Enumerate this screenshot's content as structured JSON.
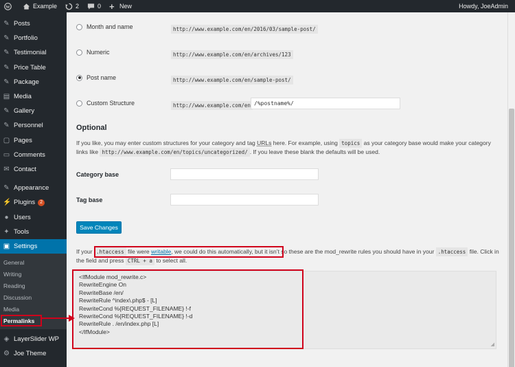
{
  "adminbar": {
    "site_name": "Example",
    "updates_count": "2",
    "comments_count": "0",
    "new_label": "New",
    "howdy": "Howdy, JoeAdmin"
  },
  "sidebar": {
    "items": [
      {
        "label": "Posts",
        "icon": "pin-icon"
      },
      {
        "label": "Portfolio",
        "icon": "pin-icon"
      },
      {
        "label": "Testimonial",
        "icon": "pin-icon"
      },
      {
        "label": "Price Table",
        "icon": "pin-icon"
      },
      {
        "label": "Package",
        "icon": "pin-icon"
      },
      {
        "label": "Media",
        "icon": "media-icon"
      },
      {
        "label": "Gallery",
        "icon": "pin-icon"
      },
      {
        "label": "Personnel",
        "icon": "pin-icon"
      },
      {
        "label": "Pages",
        "icon": "pages-icon"
      },
      {
        "label": "Comments",
        "icon": "comments-icon"
      },
      {
        "label": "Contact",
        "icon": "mail-icon"
      }
    ],
    "appearance": {
      "label": "Appearance",
      "icon": "brush-icon"
    },
    "plugins": {
      "label": "Plugins",
      "icon": "plug-icon",
      "badge": "2"
    },
    "users": {
      "label": "Users",
      "icon": "user-icon"
    },
    "tools": {
      "label": "Tools",
      "icon": "wrench-icon"
    },
    "settings": {
      "label": "Settings",
      "icon": "settings-icon"
    },
    "submenu": [
      "General",
      "Writing",
      "Reading",
      "Discussion",
      "Media",
      "Permalinks"
    ],
    "layerslider": {
      "label": "LayerSlider WP",
      "icon": "layers-icon"
    },
    "joetheme": {
      "label": "Joe Theme",
      "icon": "gear-icon"
    }
  },
  "permalinks": {
    "options": [
      {
        "label": "Month and name",
        "example": "http://www.example.com/en/2016/03/sample-post/",
        "checked": false
      },
      {
        "label": "Numeric",
        "example": "http://www.example.com/en/archives/123",
        "checked": false
      },
      {
        "label": "Post name",
        "example": "http://www.example.com/en/sample-post/",
        "checked": true
      },
      {
        "label": "Custom Structure",
        "example": "http://www.example.com/en",
        "checked": false
      }
    ],
    "custom_structure_value": "/%postname%/"
  },
  "optional": {
    "heading": "Optional",
    "desc_part1": "If you like, you may enter custom structures for your category and tag ",
    "desc_urls": "URLs",
    "desc_part2": " here. For example, using ",
    "desc_code1": "topics",
    "desc_part3": " as your category base would make your category links like ",
    "desc_code2": "http://www.example.com/en/topics/uncategorized/",
    "desc_part4": ". If you leave these blank the defaults will be used.",
    "category_base_label": "Category base",
    "tag_base_label": "Tag base"
  },
  "save_button": "Save Changes",
  "htaccess_notice": {
    "part1": "If your ",
    "code1": ".htaccess",
    "part2": " file were ",
    "link": "writable",
    "part3": ", we could do this automatically, but it isn’t so these are the mod_rewrite rules you should have in your ",
    "code2": ".htaccess",
    "part4": " file. Click in the field and press ",
    "code3": "CTRL + a",
    "part5": " to select all."
  },
  "rewrite_rules": [
    "<IfModule mod_rewrite.c>",
    "RewriteEngine On",
    "RewriteBase /en/",
    "RewriteRule ^index\\.php$ - [L]",
    "RewriteCond %{REQUEST_FILENAME} !-f",
    "RewriteCond %{REQUEST_FILENAME} !-d",
    "RewriteRule . /en/index.php [L]",
    "</IfModule>"
  ],
  "colors": {
    "accent": "#0073aa",
    "highlight": "#d0021b",
    "sidebar": "#23282d"
  }
}
